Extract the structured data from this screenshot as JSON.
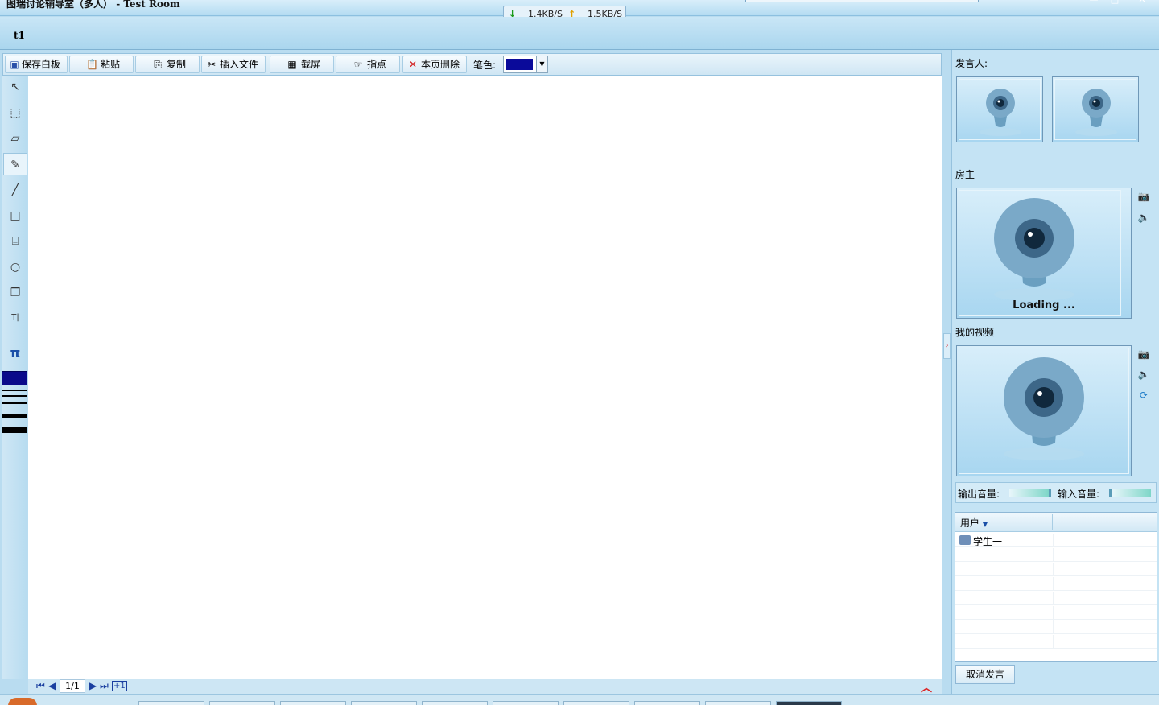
{
  "window": {
    "title": "图瑞讨论辅导室（多人）",
    "room": " - Test Room",
    "download_speed": "1.4KB/S",
    "upload_speed": "1.5KB/S"
  },
  "tabs": [
    {
      "label": "t1"
    }
  ],
  "toolbar": {
    "save": "保存白板",
    "paste": "粘贴",
    "copy": "复制",
    "insert_file": "插入文件",
    "screenshot": "截屏",
    "pointer": "指点",
    "delete_page": "本页删除",
    "pen_color_label": "笔色:",
    "pen_color": "#0a0a9a"
  },
  "tools": {
    "pi_symbol": "π"
  },
  "pagination": {
    "current": "1/1"
  },
  "right_panel": {
    "speaker_label": "发言人:",
    "host_label": "房主",
    "loading_text": "Loading ...",
    "my_video_label": "我的视频",
    "output_volume_label": "输出音量:",
    "input_volume_label": "输入音量:",
    "user_list": {
      "column_header": "用户",
      "users": [
        "学生一"
      ]
    },
    "cancel_speak": "取消发言"
  }
}
